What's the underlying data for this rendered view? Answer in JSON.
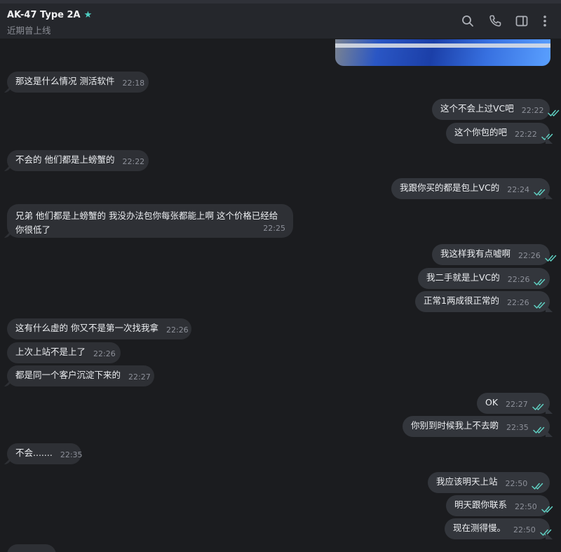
{
  "header": {
    "title": "AK-47 Type 2A",
    "status": "近期曾上线",
    "icons": [
      "search-icon",
      "phone-icon",
      "sidebar-icon",
      "more-icon"
    ]
  },
  "colors": {
    "accent": "#4fd1c5",
    "tick": "#5fd0c2"
  },
  "messages": [
    {
      "dir": "in",
      "text": "那这是什么情况 测活软件",
      "time": "22:18"
    },
    {
      "dir": "out",
      "text": "这个不会上过VC吧",
      "time": "22:22"
    },
    {
      "dir": "out",
      "text": "这个你包的吧",
      "time": "22:22"
    },
    {
      "dir": "in",
      "text": "不会的 他们都是上螃蟹的",
      "time": "22:22"
    },
    {
      "dir": "out",
      "text": "我跟你买的都是包上VC的",
      "time": "22:24"
    },
    {
      "dir": "in",
      "text": "兄弟 他们都是上螃蟹的 我没办法包你每张都能上啊 这个价格已经给你很低了",
      "time": "22:25"
    },
    {
      "dir": "out",
      "text": "我这样我有点嘘啊",
      "time": "22:26"
    },
    {
      "dir": "out",
      "text": "我二手就是上VC的",
      "time": "22:26"
    },
    {
      "dir": "out",
      "text": "正常1两成很正常的",
      "time": "22:26"
    },
    {
      "dir": "in",
      "text": "这有什么虚的 你又不是第一次找我拿",
      "time": "22:26"
    },
    {
      "dir": "in",
      "text": "上次上站不是上了",
      "time": "22:26"
    },
    {
      "dir": "in",
      "text": "都是同一个客户沉淀下来的",
      "time": "22:27"
    },
    {
      "dir": "out",
      "text": "OK",
      "time": "22:27"
    },
    {
      "dir": "out",
      "text": "你别到时候我上不去啲",
      "time": "22:35"
    },
    {
      "dir": "in",
      "text": "不会.......",
      "time": "22:35"
    },
    {
      "dir": "out",
      "text": "我应该明天上站",
      "time": "22:50"
    },
    {
      "dir": "out",
      "text": "明天跟你联系",
      "time": "22:50"
    },
    {
      "dir": "out",
      "text": "现在测得慢。",
      "time": "22:50"
    }
  ]
}
